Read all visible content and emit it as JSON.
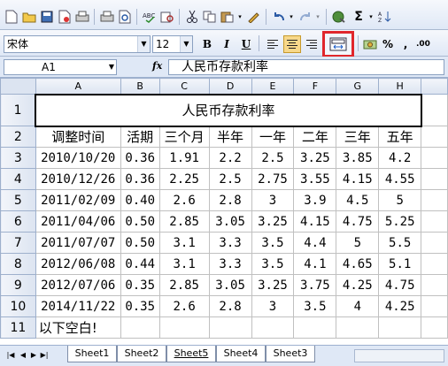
{
  "toolbar_standard": {
    "icons": [
      "new-icon",
      "open-icon",
      "save-icon",
      "permission-icon",
      "print-icon",
      "print-preview-icon",
      "spelling-icon",
      "research-icon",
      "cut-icon",
      "copy-icon",
      "paste-icon",
      "format-painter-icon",
      "undo-icon",
      "redo-icon",
      "hyperlink-icon",
      "autosum-icon",
      "sort-ascending-icon"
    ]
  },
  "toolbar_formatting": {
    "font_name": "宋体",
    "font_size": "12",
    "bold_label": "B",
    "italic_label": "I",
    "underline_label": "U",
    "percent_label": "%",
    "comma_label": ",",
    "increase_decimal_label": ".00",
    "highlight_color": "#e0262b"
  },
  "formula_bar": {
    "cell_ref": "A1",
    "fx_label": "fx",
    "value": "人民币存款利率"
  },
  "grid": {
    "columns": [
      "A",
      "B",
      "C",
      "D",
      "E",
      "F",
      "G",
      "H"
    ],
    "title": "人民币存款利率",
    "header_row": [
      "调整时间",
      "活期",
      "三个月",
      "半年",
      "一年",
      "二年",
      "三年",
      "五年"
    ],
    "rows": [
      [
        "2010/10/20",
        "0.36",
        "1.91",
        "2.2",
        "2.5",
        "3.25",
        "3.85",
        "4.2"
      ],
      [
        "2010/12/26",
        "0.36",
        "2.25",
        "2.5",
        "2.75",
        "3.55",
        "4.15",
        "4.55"
      ],
      [
        "2011/02/09",
        "0.40",
        "2.6",
        "2.8",
        "3",
        "3.9",
        "4.5",
        "5"
      ],
      [
        "2011/04/06",
        "0.50",
        "2.85",
        "3.05",
        "3.25",
        "4.15",
        "4.75",
        "5.25"
      ],
      [
        "2011/07/07",
        "0.50",
        "3.1",
        "3.3",
        "3.5",
        "4.4",
        "5",
        "5.5"
      ],
      [
        "2012/06/08",
        "0.44",
        "3.1",
        "3.3",
        "3.5",
        "4.1",
        "4.65",
        "5.1"
      ],
      [
        "2012/07/06",
        "0.35",
        "2.85",
        "3.05",
        "3.25",
        "3.75",
        "4.25",
        "4.75"
      ],
      [
        "2014/11/22",
        "0.35",
        "2.6",
        "2.8",
        "3",
        "3.5",
        "4",
        "4.25"
      ]
    ],
    "footer_text": "以下空白!",
    "row_numbers": [
      "1",
      "2",
      "3",
      "4",
      "5",
      "6",
      "7",
      "8",
      "9",
      "10",
      "11"
    ]
  },
  "sheet_tabs": [
    "Sheet1",
    "Sheet2",
    "Sheet5",
    "Sheet4",
    "Sheet3"
  ],
  "active_sheet": "Sheet5"
}
